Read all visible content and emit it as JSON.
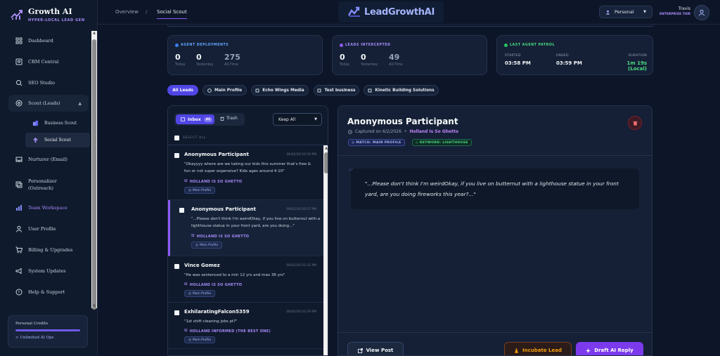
{
  "brand": {
    "title": "Growth AI",
    "subtitle": "HYPER-LOCAL LEAD GEN"
  },
  "nav": {
    "items": [
      {
        "label": "Dashboard",
        "icon": "dashboard-icon"
      },
      {
        "label": "CRM Central",
        "icon": "contacts-icon"
      },
      {
        "label": "SEO Studio",
        "icon": "search-icon"
      },
      {
        "label": "Scout (Leads)",
        "icon": "target-icon"
      },
      {
        "label": "Nurturer (Email)",
        "icon": "inbox-icon"
      },
      {
        "label": "Personalizer (Outreach)",
        "icon": "copy-icon"
      },
      {
        "label": "Team Workspace",
        "icon": "team-icon"
      },
      {
        "label": "User Profile",
        "icon": "user-icon"
      },
      {
        "label": "Billing & Upgrades",
        "icon": "cart-icon"
      },
      {
        "label": "System Updates",
        "icon": "megaphone-icon"
      },
      {
        "label": "Help & Support",
        "icon": "help-icon"
      }
    ],
    "sub_items": [
      {
        "label": "Business Scout",
        "icon": "building-icon"
      },
      {
        "label": "Social Scout",
        "icon": "megaphone-icon"
      }
    ]
  },
  "credits": {
    "label": "Personal Credits",
    "value": "∞ Unlimited AI Ops"
  },
  "topbar": {
    "crumb_overview": "Overview",
    "crumb_sep": "/",
    "crumb_active": "Social Scout",
    "logo_text": "LeadGrowthAI",
    "account": "Personal",
    "user_name": "Travis",
    "user_tier": "ENTERPRISE TIER"
  },
  "cards": {
    "deploy": {
      "title": "AGENT DEPLOYMENTS",
      "today": "0",
      "yesterday": "0",
      "all": "275",
      "l_today": "Today",
      "l_yesterday": "Yesterday",
      "l_all": "All-Time"
    },
    "leads": {
      "title": "LEADS INTERCEPTED",
      "today": "0",
      "yesterday": "0",
      "all": "49",
      "l_today": "Today",
      "l_yesterday": "Yesterday",
      "l_all": "All-Time"
    },
    "patrol": {
      "title": "LAST AGENT PATROL",
      "started_k": "STARTED",
      "started": "03:58 PM",
      "ended_k": "ENDED",
      "ended": "03:59 PM",
      "duration_k": "DURATION",
      "duration": "1m 19s (Local)"
    }
  },
  "filters": [
    "All Leads",
    "Main Profile",
    "Echo Wings Media",
    "Test business",
    "Kinetic Building Solutions"
  ],
  "list": {
    "inbox": "Inbox",
    "inbox_count": "42",
    "trash": "Trash",
    "keep": "Keep All",
    "select_all": "SELECT ALL",
    "items": [
      {
        "name": "Anonymous Participant",
        "time": "06/02/26 03:59 PM",
        "text": "\"Okayyyy where are we taking our kids this summer that's free & fun or not super expensive? Kids ages around 4-10\"",
        "group": "HOLLAND IS SO GHETTO",
        "tag": "Main Profile"
      },
      {
        "name": "Anonymous Participant",
        "time": "06/02/26 03:57 PM",
        "text": "\"...Please don't think I'm weirdOkay, if you live on butternut with a lighthouse statue in your front yard, are you doing...\"",
        "group": "HOLLAND IS SO GHETTO",
        "tag": "Main Profile"
      },
      {
        "name": "Vince Gomez",
        "time": "06/02/26 03:31 PM",
        "text": "\"He was sentenced to a min 12 yrs and max 36 yrs\"",
        "group": "HOLLAND IS SO GHETTO",
        "tag": "Main Profile"
      },
      {
        "name": "ExhilaratingFalcon5359",
        "time": "06/02/26 03:29 PM",
        "text": "\"1st shift cleaning jobs pt?\"",
        "group": "HOLLAND INFORMED (THE BEST ONE)",
        "tag": "Main Profile"
      }
    ]
  },
  "detail": {
    "title": "Anonymous Participant",
    "captured": "Captured on 6/2/2026",
    "bullet": "•",
    "group": "Holland Is So Ghetto",
    "tag_match": "MATCH: MAIN PROFILE",
    "tag_keyword": "KEYWORD: LIGHTHOUSE",
    "quote_mark": "“",
    "quote": "\"...Please don't think I'm weirdOkay, if you live on butternut with a lighthouse statue in your front yard, are you doing fireworks this year?...\"",
    "view_post": "View Post",
    "incubate": "Incubate Lead",
    "draft": "Draft AI Reply"
  }
}
